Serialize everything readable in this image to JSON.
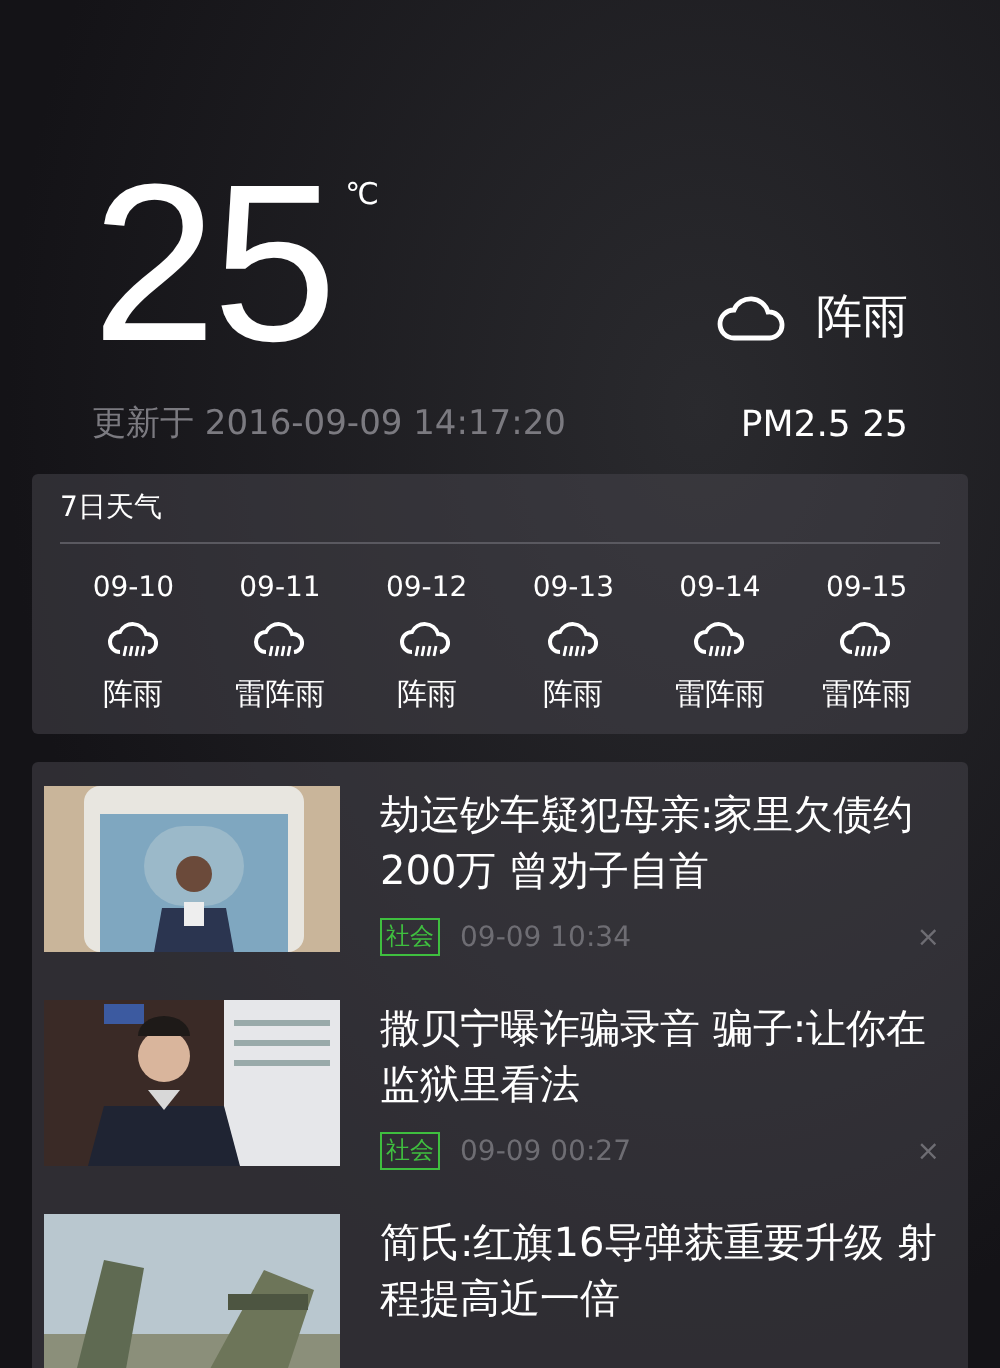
{
  "current": {
    "temperature": "25",
    "unit": "℃",
    "condition": "阵雨",
    "updated": "更新于 2016-09-09 14:17:20",
    "pm25": "PM2.5 25"
  },
  "forecast": {
    "title": "7日天气",
    "days": [
      {
        "date": "09-10",
        "condition": "阵雨"
      },
      {
        "date": "09-11",
        "condition": "雷阵雨"
      },
      {
        "date": "09-12",
        "condition": "阵雨"
      },
      {
        "date": "09-13",
        "condition": "阵雨"
      },
      {
        "date": "09-14",
        "condition": "雷阵雨"
      },
      {
        "date": "09-15",
        "condition": "雷阵雨"
      }
    ]
  },
  "news": [
    {
      "title": "劫运钞车疑犯母亲:家里欠债约200万 曾劝子自首",
      "tag": "社会",
      "time": "09-09 10:34",
      "close": "×"
    },
    {
      "title": "撒贝宁曝诈骗录音 骗子:让你在监狱里看法",
      "tag": "社会",
      "time": "09-09 00:27",
      "close": "×"
    },
    {
      "title": "简氏:红旗16导弹获重要升级 射程提高近一倍"
    }
  ]
}
